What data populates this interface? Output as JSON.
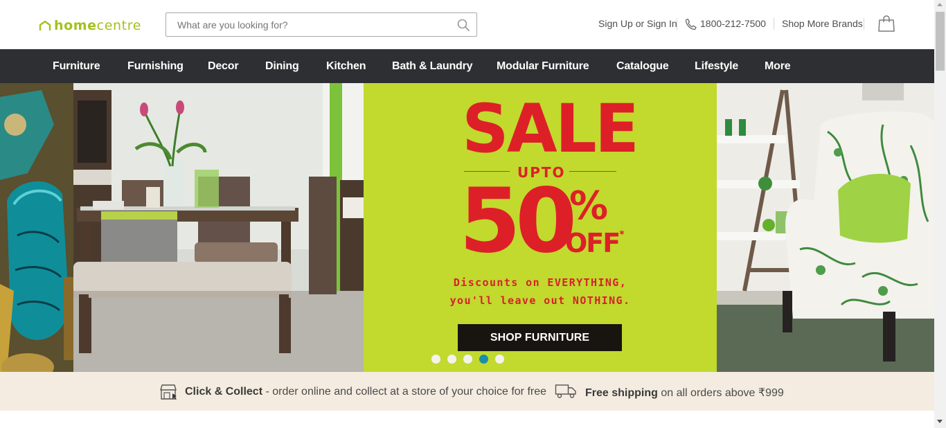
{
  "header": {
    "logo_text_bold": "home",
    "logo_text_light": "centre",
    "search_placeholder": "What are you looking for?",
    "sign_in": "Sign Up or Sign In",
    "phone": "1800-212-7500",
    "shop_more": "Shop More Brands"
  },
  "nav": {
    "items": [
      "Furniture",
      "Furnishing",
      "Decor",
      "Dining",
      "Kitchen",
      "Bath & Laundry",
      "Modular Furniture",
      "Catalogue",
      "Lifestyle",
      "More"
    ]
  },
  "hero": {
    "sale": "SALE",
    "upto": "UPTO",
    "discount": "50",
    "percent": "%",
    "off": "OFF",
    "off_mark": "*",
    "line1": "Discounts on EVERYTHING,",
    "line2": "you'll leave out NOTHING.",
    "cta": "SHOP FURNITURE",
    "slides_count": 5,
    "active_slide": 4
  },
  "strip": {
    "collect_bold": "Click & Collect",
    "collect_text": " - order online and collect at a store of your choice for free",
    "ship_bold": "Free shipping",
    "ship_text": " on all orders above ",
    "ship_currency": "₹",
    "ship_amount": "999"
  },
  "colors": {
    "brand_green": "#a2c11c",
    "nav_bg": "#2e2f33",
    "sale_bg": "#c2d92e",
    "sale_red": "#dd2028",
    "strip_bg": "#f4ece0",
    "dot_active": "#1a8fa7"
  },
  "icons": [
    "house-logo-icon",
    "search-icon",
    "phone-icon",
    "shopping-bag-icon",
    "store-icon",
    "truck-icon"
  ]
}
